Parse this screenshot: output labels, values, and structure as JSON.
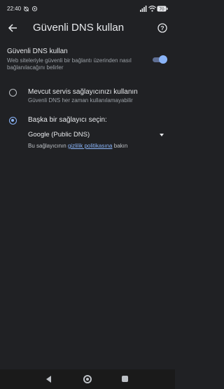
{
  "status_bar": {
    "time": "22:40",
    "battery": "70",
    "icons": [
      "alarm-off-icon",
      "vpn-icon",
      "signal-icon",
      "wifi-icon",
      "battery-icon"
    ]
  },
  "header": {
    "title": "Güvenli DNS kullan",
    "back_icon": "arrow-back-icon",
    "help_icon": "help-icon"
  },
  "secure_dns": {
    "title": "Güvenli DNS kullan",
    "description": "Web siteleriyle güvenli bir bağlantı üzerinden nasıl bağlanılacağını belirler",
    "enabled": true
  },
  "options": [
    {
      "label": "Mevcut servis sağlayıcınızı kullanın",
      "sublabel": "Güvenli DNS her zaman kullanılamayabilir",
      "selected": false
    },
    {
      "label": "Başka bir sağlayıcı seçin:",
      "sublabel": "",
      "selected": true
    }
  ],
  "provider": {
    "selected": "Google (Public DNS)",
    "privacy_prefix": "Bu sağlayıcının ",
    "privacy_link": "gizlilik politikasına",
    "privacy_suffix": " bakın"
  },
  "nav_bar": {
    "icons": [
      "nav-back-icon",
      "nav-home-icon",
      "nav-recents-icon"
    ]
  },
  "colors": {
    "background": "#202124",
    "accent": "#8ab4f8",
    "text_primary": "#e8eaed",
    "text_secondary": "#9aa0a6"
  }
}
